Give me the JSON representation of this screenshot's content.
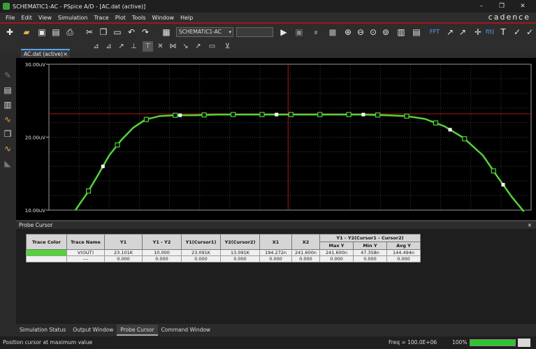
{
  "window": {
    "title": "SCHEMATIC1-AC - PSpice A/D - [AC.dat (active)]",
    "controls": [
      "–",
      "❐",
      "✕"
    ]
  },
  "menu": {
    "items": [
      "File",
      "Edit",
      "View",
      "Simulation",
      "Trace",
      "Plot",
      "Tools",
      "Window",
      "Help"
    ],
    "brand": "cadence"
  },
  "toolbar": {
    "profile_select": "SCHEMATIC1-AC",
    "fft_label": "FFT",
    "ft_label": "f(t)"
  },
  "document": {
    "tab_label": "AC.dat (active)",
    "tab_close": "×"
  },
  "colors": {
    "trace": "#54d33a",
    "cursor_line": "#b01616",
    "grid": "#3a3a3a",
    "accent": "#a5151a"
  },
  "chart_data": {
    "type": "line",
    "ylim": [
      10,
      30
    ],
    "yticks": [
      {
        "value": 30,
        "label": "30.00uV"
      },
      {
        "value": 20,
        "label": "20.00uV"
      },
      {
        "value": 10,
        "label": "10.00uV"
      }
    ],
    "cursor_y": 23.2,
    "cursor_x_frac": 0.496,
    "series": [
      {
        "points": [
          [
            0.055,
            10
          ],
          [
            0.08,
            12.4
          ],
          [
            0.1,
            14.6
          ],
          [
            0.125,
            17.5
          ],
          [
            0.15,
            19.6
          ],
          [
            0.175,
            21.3
          ],
          [
            0.2,
            22.4
          ],
          [
            0.23,
            22.9
          ],
          [
            0.26,
            23.0
          ],
          [
            0.3,
            23.0
          ],
          [
            0.35,
            23.1
          ],
          [
            0.4,
            23.1
          ],
          [
            0.45,
            23.1
          ],
          [
            0.5,
            23.1
          ],
          [
            0.55,
            23.1
          ],
          [
            0.6,
            23.1
          ],
          [
            0.65,
            23.1
          ],
          [
            0.7,
            23.0
          ],
          [
            0.74,
            22.9
          ],
          [
            0.78,
            22.5
          ],
          [
            0.82,
            21.5
          ],
          [
            0.86,
            19.9
          ],
          [
            0.9,
            17.5
          ],
          [
            0.93,
            14.6
          ],
          [
            0.96,
            11.8
          ],
          [
            0.985,
            9.8
          ]
        ],
        "markers_square": [
          0.082,
          0.142,
          0.202,
          0.262,
          0.322,
          0.382,
          0.442,
          0.502,
          0.562,
          0.622,
          0.682,
          0.742,
          0.802,
          0.862,
          0.922
        ],
        "markers_filled": [
          0.112,
          0.272,
          0.472,
          0.652,
          0.832,
          0.942
        ]
      }
    ]
  },
  "probe_panel": {
    "title": "Probe Cursor",
    "close": "×",
    "headers": [
      "Trace Color",
      "Trace Name",
      "Y1",
      "Y1 - Y2",
      "Y1(Cursor1)",
      "Y2(Cursor2)",
      "X1",
      "X2"
    ],
    "group_header": "Y1 - Y2(Cursor1 - Cursor2)",
    "sub_headers": [
      "Max Y",
      "Min Y",
      "Avg Y"
    ],
    "rows": [
      [
        "",
        "V(OUT)",
        "23.101K",
        "10.000",
        "23.091K",
        "13.091K",
        "194.272n",
        "241.600n",
        "241.600n",
        "47.358n",
        "144.494n"
      ],
      [
        "",
        "---",
        "0.000",
        "0.000",
        "0.000",
        "0.000",
        "0.000",
        "0.000",
        "0.000",
        "0.000",
        "0.000"
      ]
    ]
  },
  "bottom_tabs": [
    "Simulation Status",
    "Output Window",
    "Probe Cursor",
    "Command Window"
  ],
  "bottom_tab_active": "Probe Cursor",
  "status": {
    "message": "Position cursor at maximum value",
    "freq": "Freq = 100.0E+06",
    "percent": "100%",
    "progress": 1.0
  }
}
